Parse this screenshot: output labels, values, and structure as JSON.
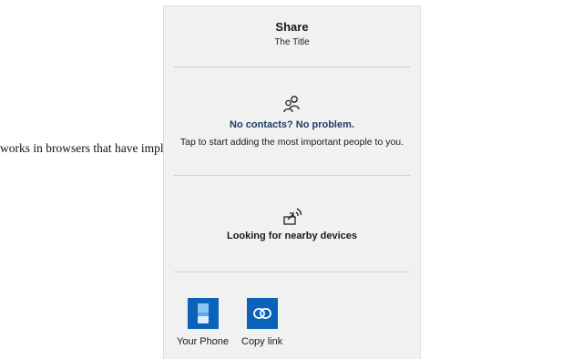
{
  "background": {
    "text": "works in browsers that have imple"
  },
  "share": {
    "title": "Share",
    "subtitle": "The Title",
    "contacts": {
      "heading": "No contacts? No problem.",
      "description": "Tap to start adding the most important people to you.",
      "icon": "people-icon"
    },
    "nearby": {
      "label": "Looking for nearby devices",
      "icon": "nearby-share-icon"
    },
    "apps": [
      {
        "label": "Your Phone",
        "icon": "phone-icon"
      },
      {
        "label": "Copy link",
        "icon": "link-icon"
      }
    ]
  },
  "colors": {
    "panel": "#f1f1f1",
    "accent": "#0a63b8",
    "heading": "#1f3d68"
  }
}
